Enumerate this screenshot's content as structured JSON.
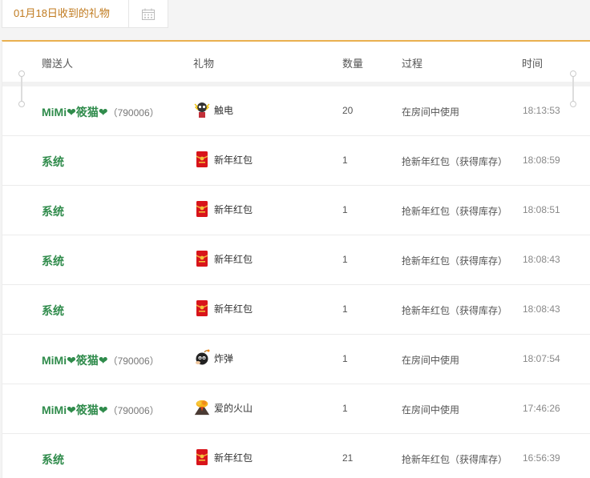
{
  "header": {
    "date_tab_label": "01月18日收到的礼物",
    "calendar_icon": "calendar-icon"
  },
  "table": {
    "columns": [
      "赠送人",
      "礼物",
      "数量",
      "过程",
      "时间"
    ],
    "rows": [
      {
        "sender": "MiMi❤筱猫❤",
        "uid": "（790006）",
        "gift_icon": "shock-icon",
        "gift": "触电",
        "qty": "20",
        "process": "在房间中使用",
        "time": "18:13:53"
      },
      {
        "sender": "系统",
        "uid": "",
        "gift_icon": "red-envelope-icon",
        "gift": "新年红包",
        "qty": "1",
        "process": "抢新年红包（获得库存）",
        "time": "18:08:59"
      },
      {
        "sender": "系统",
        "uid": "",
        "gift_icon": "red-envelope-icon",
        "gift": "新年红包",
        "qty": "1",
        "process": "抢新年红包（获得库存）",
        "time": "18:08:51"
      },
      {
        "sender": "系统",
        "uid": "",
        "gift_icon": "red-envelope-icon",
        "gift": "新年红包",
        "qty": "1",
        "process": "抢新年红包（获得库存）",
        "time": "18:08:43"
      },
      {
        "sender": "系统",
        "uid": "",
        "gift_icon": "red-envelope-icon",
        "gift": "新年红包",
        "qty": "1",
        "process": "抢新年红包（获得库存）",
        "time": "18:08:43"
      },
      {
        "sender": "MiMi❤筱猫❤",
        "uid": "（790006）",
        "gift_icon": "bomb-icon",
        "gift": "炸弹",
        "qty": "1",
        "process": "在房间中使用",
        "time": "18:07:54"
      },
      {
        "sender": "MiMi❤筱猫❤",
        "uid": "（790006）",
        "gift_icon": "volcano-icon",
        "gift": "爱的火山",
        "qty": "1",
        "process": "在房间中使用",
        "time": "17:46:26"
      },
      {
        "sender": "系统",
        "uid": "",
        "gift_icon": "red-envelope-icon",
        "gift": "新年红包",
        "qty": "21",
        "process": "抢新年红包（获得库存）",
        "time": "16:56:39"
      }
    ]
  },
  "colors": {
    "accent": "#e9b04f",
    "sender_green": "#2f8b4b",
    "date_tab_text": "#c07a1e"
  }
}
